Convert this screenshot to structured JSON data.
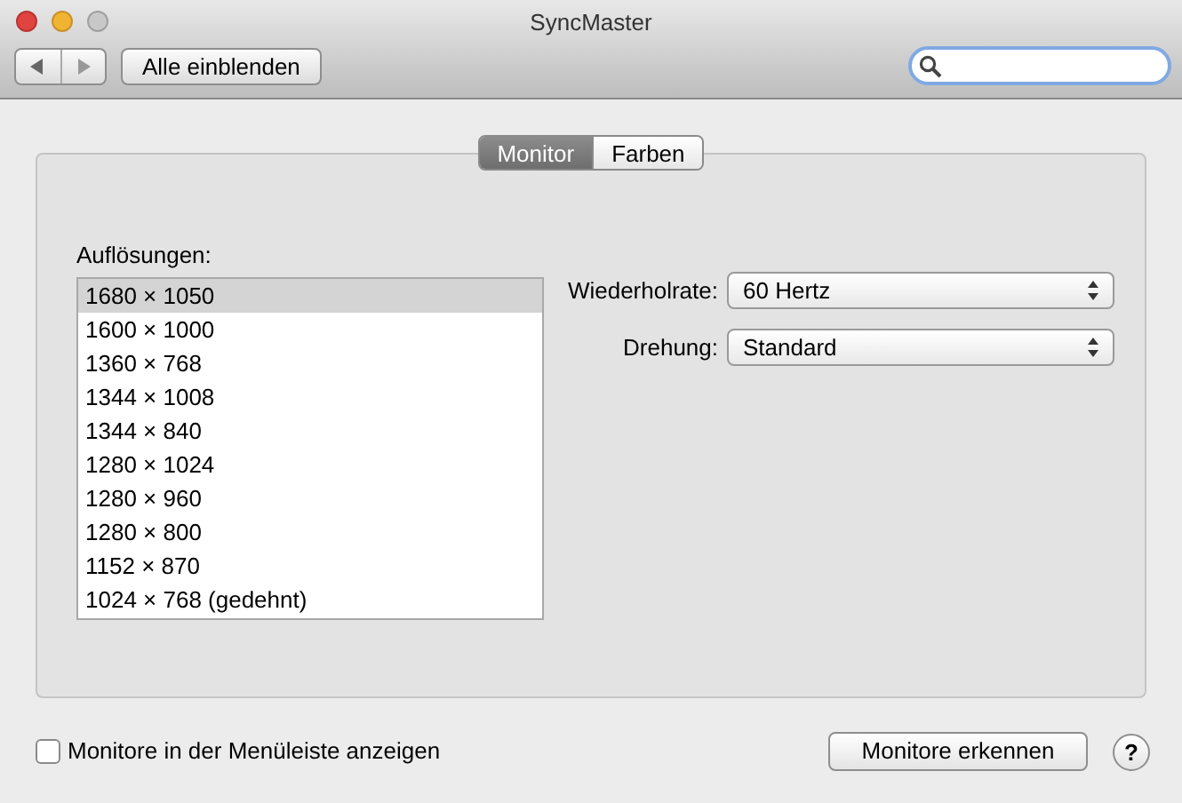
{
  "window": {
    "title": "SyncMaster"
  },
  "toolbar": {
    "show_all_button": "Alle einblenden"
  },
  "tabs": [
    {
      "label": "Monitor",
      "selected": true
    },
    {
      "label": "Farben",
      "selected": false
    }
  ],
  "resolutions": {
    "label": "Auflösungen:",
    "items": [
      {
        "label": "1680 × 1050",
        "selected": true
      },
      {
        "label": "1600 × 1000",
        "selected": false
      },
      {
        "label": "1360 × 768",
        "selected": false
      },
      {
        "label": "1344 × 1008",
        "selected": false
      },
      {
        "label": "1344 × 840",
        "selected": false
      },
      {
        "label": "1280 × 1024",
        "selected": false
      },
      {
        "label": "1280 × 960",
        "selected": false
      },
      {
        "label": "1280 × 800",
        "selected": false
      },
      {
        "label": "1152 × 870",
        "selected": false
      },
      {
        "label": "1024 × 768 (gedehnt)",
        "selected": false
      }
    ]
  },
  "settings": [
    {
      "label": "Wiederholrate:",
      "value": "60 Hertz"
    },
    {
      "label": "Drehung:",
      "value": "Standard"
    }
  ],
  "show_in_menu_bar": {
    "label": "Monitore in der Menüleiste anzeigen",
    "checked": false
  },
  "detect_button": "Monitore erkennen",
  "help_button": "?"
}
